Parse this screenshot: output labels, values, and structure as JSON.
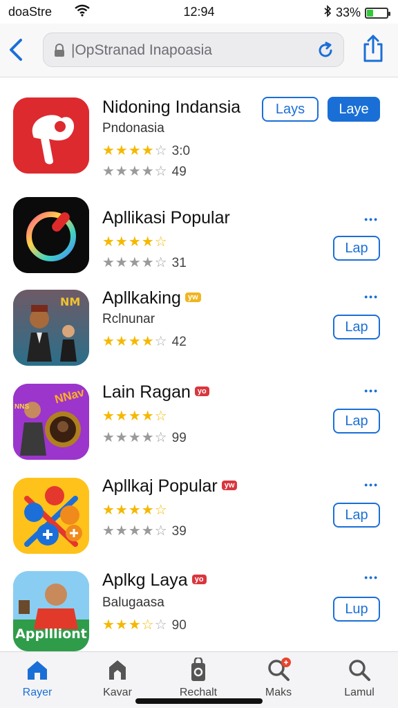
{
  "status": {
    "carrier": "doaStre",
    "time": "12:94",
    "battery": "33%",
    "battery_level": 0.33
  },
  "toolbar": {
    "url": "|OpStranad Inapoasia",
    "back_icon": "chevron-left-icon",
    "lock_icon": "lock-icon",
    "reload_icon": "reload-icon",
    "share_icon": "share-icon"
  },
  "apps": [
    {
      "title": "Nidoning Indansia",
      "subtitle": "Pndonasia",
      "rating": "3:0",
      "rating_stars": 4,
      "secondary_count": "49",
      "buttons": [
        "Lays",
        "Laye"
      ]
    },
    {
      "title": "Apllikasi Popular",
      "rating_stars": 4,
      "secondary_count": "31",
      "button": "Lap"
    },
    {
      "title": "Apllkaking",
      "tag": "yw",
      "subtitle": "Rclnunar",
      "rating": "42",
      "rating_stars": 4,
      "button": "Lap"
    },
    {
      "title": "Lain Ragan",
      "tag": "yo",
      "rating_stars": 4,
      "secondary_count": "99",
      "button": "Lap"
    },
    {
      "title": "Apllkaj Popular",
      "tag": "yw",
      "rating_stars": 4,
      "secondary_count": "39",
      "button": "Lap"
    },
    {
      "title": "Aplkg Laya",
      "tag": "yo",
      "subtitle": "Balugaasa",
      "rating": "90",
      "rating_stars": 3,
      "button": "Lup",
      "icon_text": "Appllliont"
    }
  ],
  "icon_texts": {
    "app3": "NM",
    "app4_left": "NNS",
    "app4_right": "NNav"
  },
  "tabs": [
    {
      "label": "Rayer",
      "icon": "home-icon",
      "active": true
    },
    {
      "label": "Kavar",
      "icon": "store-icon",
      "active": false
    },
    {
      "label": "Rechalt",
      "icon": "bag-icon",
      "active": false
    },
    {
      "label": "Maks",
      "icon": "search-badge-icon",
      "active": false
    },
    {
      "label": "Lamul",
      "icon": "search-icon",
      "active": false
    }
  ],
  "colors": {
    "accent": "#1a6fd6",
    "star": "#f5b800",
    "tag": "#d9363e"
  }
}
